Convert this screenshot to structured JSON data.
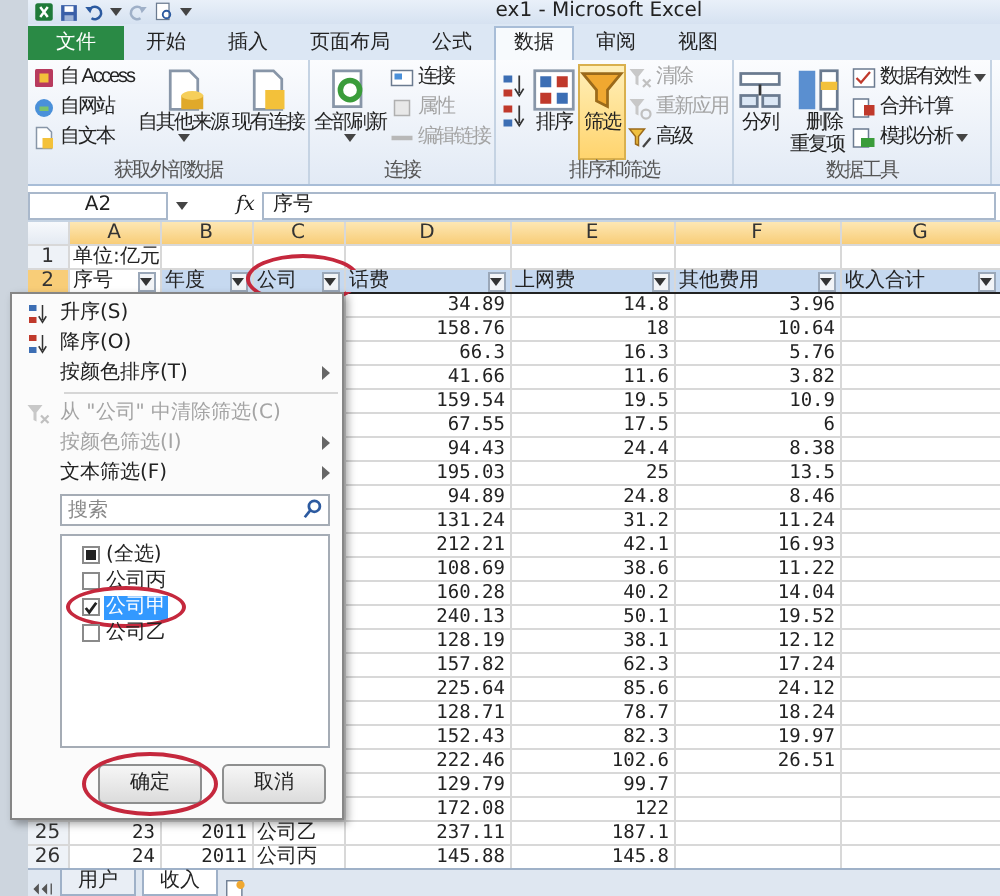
{
  "window": {
    "title": "ex1 - Microsoft Excel"
  },
  "tabs": [
    {
      "label": "文件",
      "kind": "file",
      "selected": false
    },
    {
      "label": "开始",
      "kind": "tab",
      "selected": false
    },
    {
      "label": "插入",
      "kind": "tab",
      "selected": false
    },
    {
      "label": "页面布局",
      "kind": "tab",
      "selected": false
    },
    {
      "label": "公式",
      "kind": "tab",
      "selected": false
    },
    {
      "label": "数据",
      "kind": "tab",
      "selected": true
    },
    {
      "label": "审阅",
      "kind": "tab",
      "selected": false
    },
    {
      "label": "视图",
      "kind": "tab",
      "selected": false
    }
  ],
  "ribbon": {
    "groups": [
      {
        "label": "获取外部数据",
        "columns": [
          {
            "kind": "stack",
            "buttons": [
              {
                "label": "自 Access",
                "disabled": false,
                "dropdown": false
              },
              {
                "label": "自网站",
                "disabled": false,
                "dropdown": false
              },
              {
                "label": "自文本",
                "disabled": false,
                "dropdown": false
              }
            ]
          },
          {
            "kind": "large",
            "buttons": [
              {
                "label": "自其他来源",
                "disabled": false,
                "dropdown": true,
                "selected": false
              }
            ]
          },
          {
            "kind": "large",
            "buttons": [
              {
                "label": "现有连接",
                "disabled": false,
                "dropdown": false,
                "selected": false
              }
            ]
          }
        ]
      },
      {
        "label": "连接",
        "columns": [
          {
            "kind": "large",
            "buttons": [
              {
                "label": "全部刷新",
                "disabled": false,
                "dropdown": true,
                "selected": false
              }
            ]
          },
          {
            "kind": "stack",
            "buttons": [
              {
                "label": "连接",
                "disabled": false,
                "dropdown": false
              },
              {
                "label": "属性",
                "disabled": true,
                "dropdown": false
              },
              {
                "label": "编辑链接",
                "disabled": true,
                "dropdown": false
              }
            ]
          }
        ]
      },
      {
        "label": "排序和筛选",
        "columns": [
          {
            "kind": "icons",
            "buttons": [
              {
                "disabled": false
              },
              {
                "disabled": false
              }
            ]
          },
          {
            "kind": "large",
            "buttons": [
              {
                "label": "排序",
                "disabled": false,
                "dropdown": false,
                "selected": false
              }
            ]
          },
          {
            "kind": "large",
            "buttons": [
              {
                "label": "筛选",
                "disabled": false,
                "dropdown": false,
                "selected": true
              }
            ]
          },
          {
            "kind": "stack",
            "buttons": [
              {
                "label": "清除",
                "disabled": true,
                "dropdown": false
              },
              {
                "label": "重新应用",
                "disabled": true,
                "dropdown": false
              },
              {
                "label": "高级",
                "disabled": false,
                "dropdown": false
              }
            ]
          }
        ]
      },
      {
        "label": "数据工具",
        "columns": [
          {
            "kind": "large",
            "buttons": [
              {
                "label": "分列",
                "disabled": false,
                "dropdown": false,
                "selected": false
              }
            ]
          },
          {
            "kind": "large",
            "buttons": [
              {
                "label": "删除重复项",
                "disabled": false,
                "dropdown": false,
                "selected": false
              }
            ]
          },
          {
            "kind": "stack",
            "buttons": [
              {
                "label": "数据有效性",
                "disabled": false,
                "dropdown": true
              },
              {
                "label": "合并计算",
                "disabled": false,
                "dropdown": false
              },
              {
                "label": "模拟分析",
                "disabled": false,
                "dropdown": true
              }
            ]
          }
        ]
      }
    ]
  },
  "formula_bar": {
    "name_box": "A2",
    "function_label": "fx",
    "value": "序号"
  },
  "sheet": {
    "columns": [
      {
        "label": "A",
        "selected": true
      },
      {
        "label": "B",
        "selected": true
      },
      {
        "label": "C",
        "selected": true
      },
      {
        "label": "D",
        "selected": true
      },
      {
        "label": "E",
        "selected": true
      },
      {
        "label": "F",
        "selected": true
      },
      {
        "label": "G",
        "selected": true
      }
    ],
    "rows": [
      {
        "number": "1",
        "selected": false,
        "kind": "data",
        "cells": {
          "a": "单位:亿元"
        }
      },
      {
        "number": "2",
        "selected": true,
        "kind": "header",
        "cells": [
          {
            "text": "序号",
            "circled": false
          },
          {
            "text": "年度",
            "circled": false
          },
          {
            "text": "公司",
            "circled": true
          },
          {
            "text": "话费",
            "circled": false
          },
          {
            "text": "上网费",
            "circled": false
          },
          {
            "text": "其他费用",
            "circled": false
          },
          {
            "text": "收入合计",
            "circled": false
          }
        ]
      },
      {
        "kind": "data",
        "cells": {
          "d": "34.89",
          "e": "14.8",
          "f": "3.96"
        }
      },
      {
        "kind": "data",
        "cells": {
          "d": "158.76",
          "e": "18",
          "f": "10.64"
        }
      },
      {
        "kind": "data",
        "cells": {
          "d": "66.3",
          "e": "16.3",
          "f": "5.76"
        }
      },
      {
        "kind": "data",
        "cells": {
          "d": "41.66",
          "e": "11.6",
          "f": "3.82"
        }
      },
      {
        "kind": "data",
        "cells": {
          "d": "159.54",
          "e": "19.5",
          "f": "10.9"
        }
      },
      {
        "kind": "data",
        "cells": {
          "d": "67.55",
          "e": "17.5",
          "f": "6"
        }
      },
      {
        "kind": "data",
        "cells": {
          "d": "94.43",
          "e": "24.4",
          "f": "8.38"
        }
      },
      {
        "kind": "data",
        "cells": {
          "d": "195.03",
          "e": "25",
          "f": "13.5"
        }
      },
      {
        "kind": "data",
        "cells": {
          "d": "94.89",
          "e": "24.8",
          "f": "8.46"
        }
      },
      {
        "kind": "data",
        "cells": {
          "d": "131.24",
          "e": "31.2",
          "f": "11.24"
        }
      },
      {
        "kind": "data",
        "cells": {
          "d": "212.21",
          "e": "42.1",
          "f": "16.93"
        }
      },
      {
        "kind": "data",
        "cells": {
          "d": "108.69",
          "e": "38.6",
          "f": "11.22"
        }
      },
      {
        "kind": "data",
        "cells": {
          "d": "160.28",
          "e": "40.2",
          "f": "14.04"
        }
      },
      {
        "kind": "data",
        "cells": {
          "d": "240.13",
          "e": "50.1",
          "f": "19.52"
        }
      },
      {
        "kind": "data",
        "cells": {
          "d": "128.19",
          "e": "38.1",
          "f": "12.12"
        }
      },
      {
        "kind": "data",
        "cells": {
          "d": "157.82",
          "e": "62.3",
          "f": "17.24"
        }
      },
      {
        "kind": "data",
        "cells": {
          "d": "225.64",
          "e": "85.6",
          "f": "24.12"
        }
      },
      {
        "kind": "data",
        "cells": {
          "d": "128.71",
          "e": "78.7",
          "f": "18.24"
        }
      },
      {
        "kind": "data",
        "cells": {
          "d": "152.43",
          "e": "82.3",
          "f": "19.97"
        }
      },
      {
        "kind": "data",
        "cells": {
          "d": "222.46",
          "e": "102.6",
          "f": "26.51"
        }
      },
      {
        "kind": "data",
        "cells": {
          "d": "129.79",
          "e": "99.7"
        }
      },
      {
        "kind": "data",
        "cells": {
          "d": "172.08",
          "e": "122"
        }
      },
      {
        "number": "25",
        "selected": false,
        "kind": "data",
        "cells": {
          "a": "23",
          "b": "2011",
          "c": "公司乙",
          "d": "237.11",
          "e": "187.1"
        }
      },
      {
        "number": "26",
        "selected": false,
        "kind": "data",
        "cells": {
          "a": "24",
          "b": "2011",
          "c": "公司丙",
          "d": "145.88",
          "e": "145.8"
        }
      }
    ]
  },
  "filter_menu": {
    "items": [
      {
        "kind": "command",
        "label": "升序(S)",
        "disabled": false,
        "submenu": false
      },
      {
        "kind": "command",
        "label": "降序(O)",
        "disabled": false,
        "submenu": false
      },
      {
        "kind": "command",
        "label": "按颜色排序(T)",
        "disabled": false,
        "submenu": true
      },
      {
        "kind": "separator"
      },
      {
        "kind": "command",
        "label": "从 \"公司\" 中清除筛选(C)",
        "disabled": true,
        "submenu": false
      },
      {
        "kind": "command",
        "label": "按颜色筛选(I)",
        "disabled": true,
        "submenu": true
      },
      {
        "kind": "command",
        "label": "文本筛选(F)",
        "disabled": false,
        "submenu": true
      }
    ],
    "search": {
      "placeholder": "搜索"
    },
    "values": [
      {
        "label": "(全选)",
        "checked": false,
        "mixed": true,
        "selected": false,
        "circled": false
      },
      {
        "label": "公司丙",
        "checked": false,
        "mixed": false,
        "selected": false,
        "circled": false
      },
      {
        "label": "公司甲",
        "checked": true,
        "mixed": false,
        "selected": true,
        "circled": true
      },
      {
        "label": "公司乙",
        "checked": false,
        "mixed": false,
        "selected": false,
        "circled": false
      }
    ],
    "buttons": [
      {
        "label": "确定",
        "circled": true
      },
      {
        "label": "取消",
        "circled": false
      }
    ]
  },
  "sheet_tabs": [
    {
      "label": "用户",
      "selected": false
    },
    {
      "label": "收入",
      "selected": true
    }
  ]
}
